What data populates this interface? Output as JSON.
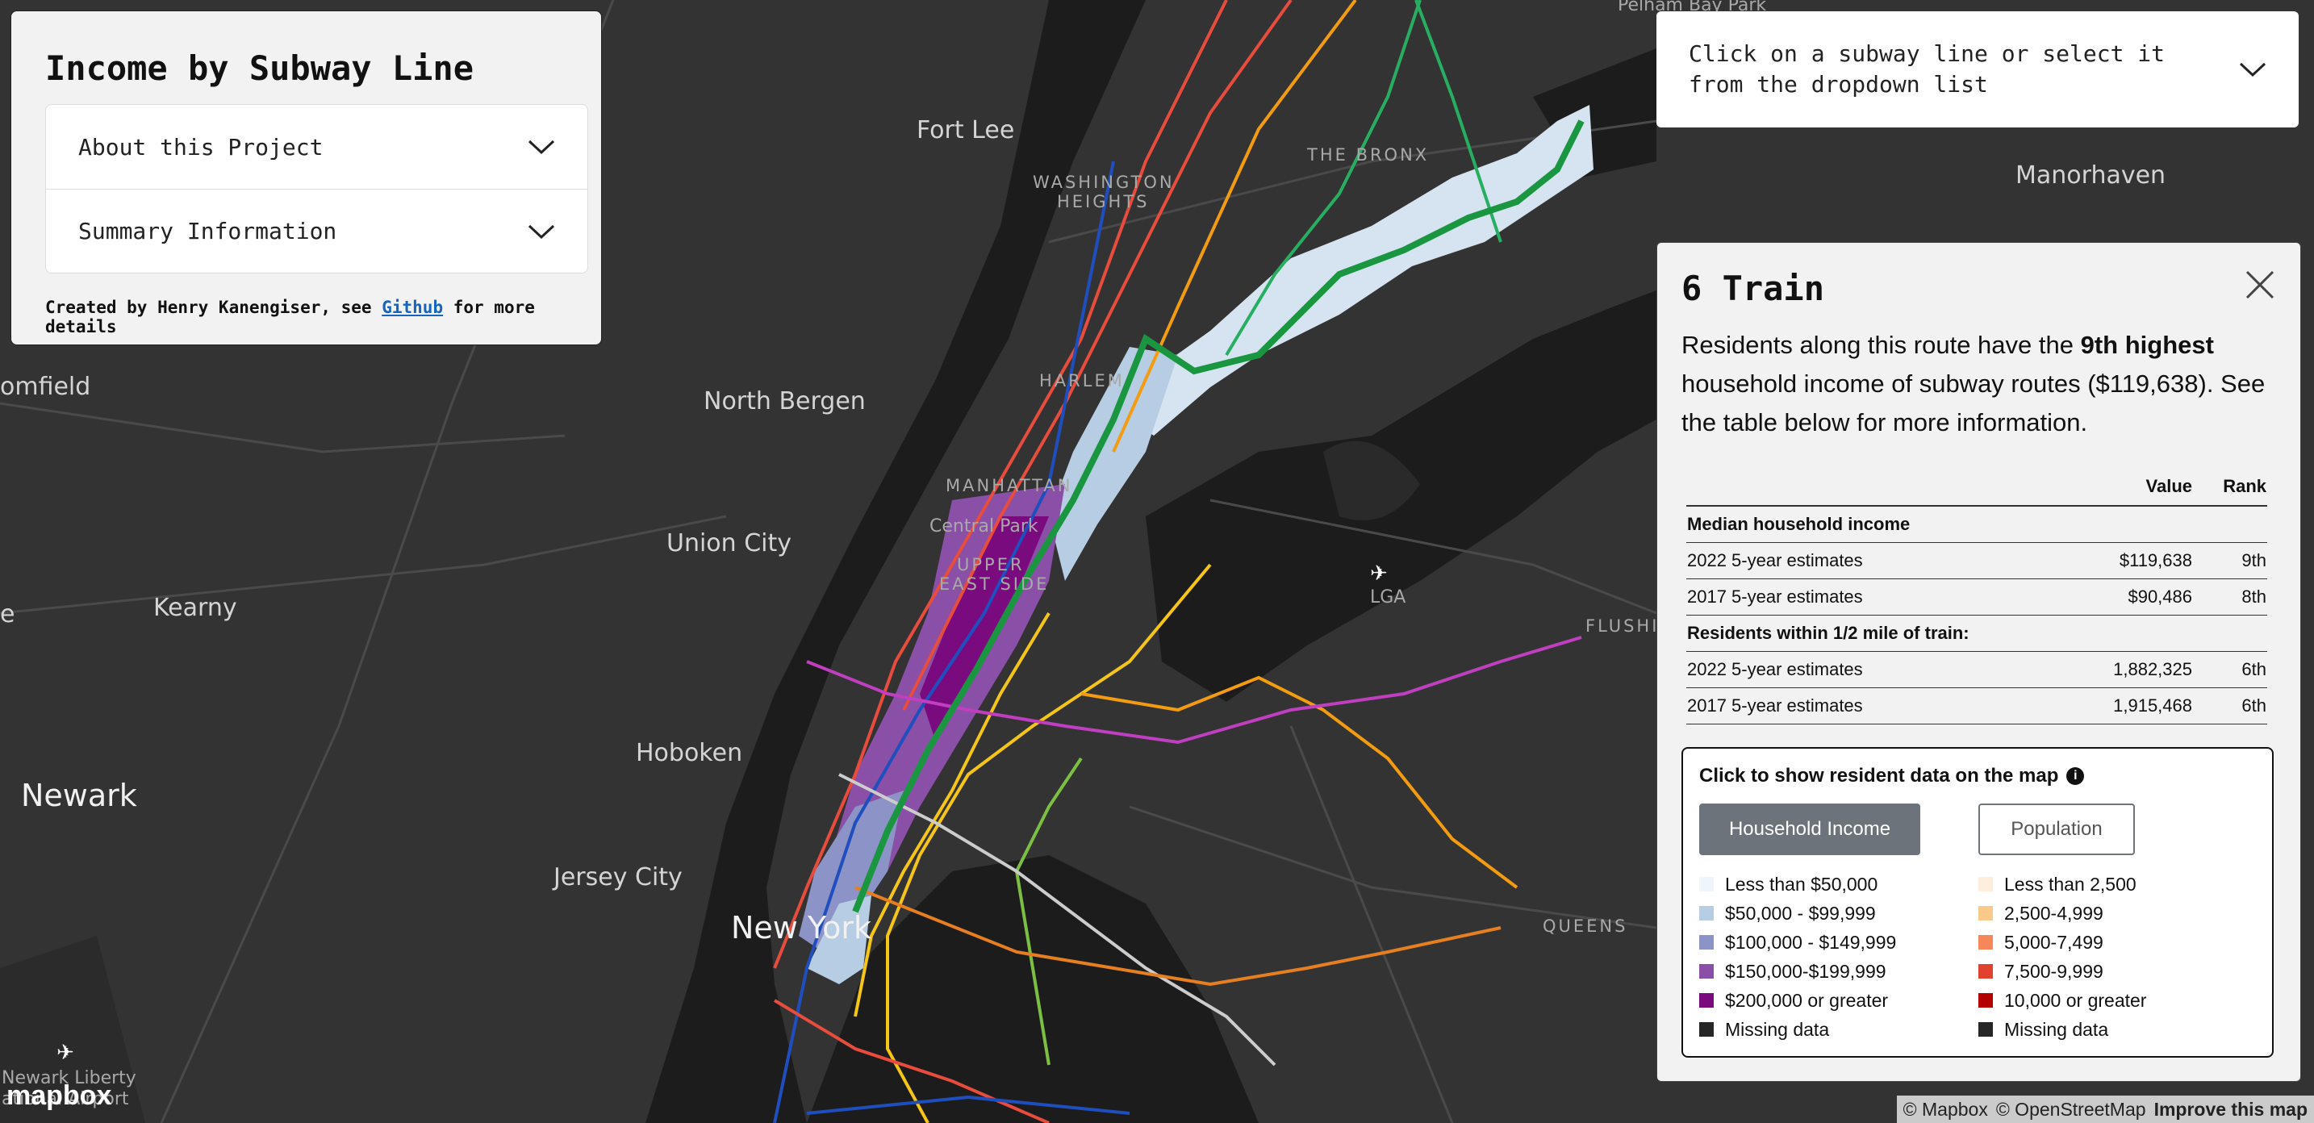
{
  "map": {
    "labels": {
      "fort_lee": "Fort Lee",
      "washington_heights_1": "WASHINGTON",
      "washington_heights_2": "HEIGHTS",
      "bronx": "THE BRONX",
      "pelham": "Pelham Bay Park",
      "manorhaven": "Manorhaven",
      "bloomfield": "omfield",
      "north_bergen": "North Bergen",
      "harlem": "HARLEM",
      "manhattan": "MANHATTAN",
      "central_park": "Central Park",
      "upper_east_1": "UPPER",
      "upper_east_2": "EAST SIDE",
      "union_city": "Union City",
      "kearny": "Kearny",
      "lga": "LGA",
      "flushing": "FLUSHIN",
      "hoboken": "Hoboken",
      "newark": "Newark",
      "jersey_city": "Jersey City",
      "new_york": "New York",
      "queens": "QUEENS",
      "newark_airport_1": "Newark Liberty",
      "newark_airport_2": "ational Airport",
      "e_fragment": "e"
    },
    "mapbox_logo": "mapbox",
    "attribution": {
      "mapbox": "© Mapbox",
      "osm": "© OpenStreetMap",
      "improve": "Improve this map"
    }
  },
  "panel": {
    "title": "Income by Subway Line",
    "accordion": [
      {
        "label": "About this Project"
      },
      {
        "label": "Summary Information"
      }
    ],
    "credit_prefix": "Created by Henry Kanengiser, see ",
    "credit_link": "Github",
    "credit_suffix": " for more details"
  },
  "dropdown": {
    "placeholder": "Click on a subway line or select it from the dropdown list"
  },
  "detail": {
    "title": "6 Train",
    "summary_prefix": "Residents along this route have the ",
    "summary_rank": "9th highest",
    "summary_suffix": " household income of subway routes ($119,638). See the table below for more information.",
    "table": {
      "headers": [
        "",
        "Value",
        "Rank"
      ],
      "group1": "Median household income",
      "income_rows": [
        {
          "label": "2022 5-year estimates",
          "value": "$119,638",
          "rank": "9th"
        },
        {
          "label": "2017 5-year estimates",
          "value": "$90,486",
          "rank": "8th"
        }
      ],
      "group2": "Residents within 1/2 mile of train:",
      "pop_rows": [
        {
          "label": "2022 5-year estimates",
          "value": "1,882,325",
          "rank": "6th"
        },
        {
          "label": "2017 5-year estimates",
          "value": "1,915,468",
          "rank": "6th"
        }
      ]
    },
    "legend": {
      "title": "Click to show resident data on the map",
      "btn_income": "Household Income",
      "btn_population": "Population",
      "income": [
        {
          "label": "Less than $50,000",
          "color": "#eef6fb"
        },
        {
          "label": "$50,000 - $99,999",
          "color": "#b7cde3"
        },
        {
          "label": "$100,000 - $149,999",
          "color": "#8c93c6"
        },
        {
          "label": "$150,000-$199,999",
          "color": "#8a4fa6"
        },
        {
          "label": "$200,000 or greater",
          "color": "#7a0b7e"
        },
        {
          "label": "Missing data",
          "color": "#262626"
        }
      ],
      "population": [
        {
          "label": "Less than 2,500",
          "color": "#feeedb"
        },
        {
          "label": "2,500-4,999",
          "color": "#fbc98a"
        },
        {
          "label": "5,000-7,499",
          "color": "#f6875a"
        },
        {
          "label": "7,500-9,999",
          "color": "#e0422f"
        },
        {
          "label": "10,000 or greater",
          "color": "#b30000"
        },
        {
          "label": "Missing data",
          "color": "#262626"
        }
      ]
    }
  }
}
